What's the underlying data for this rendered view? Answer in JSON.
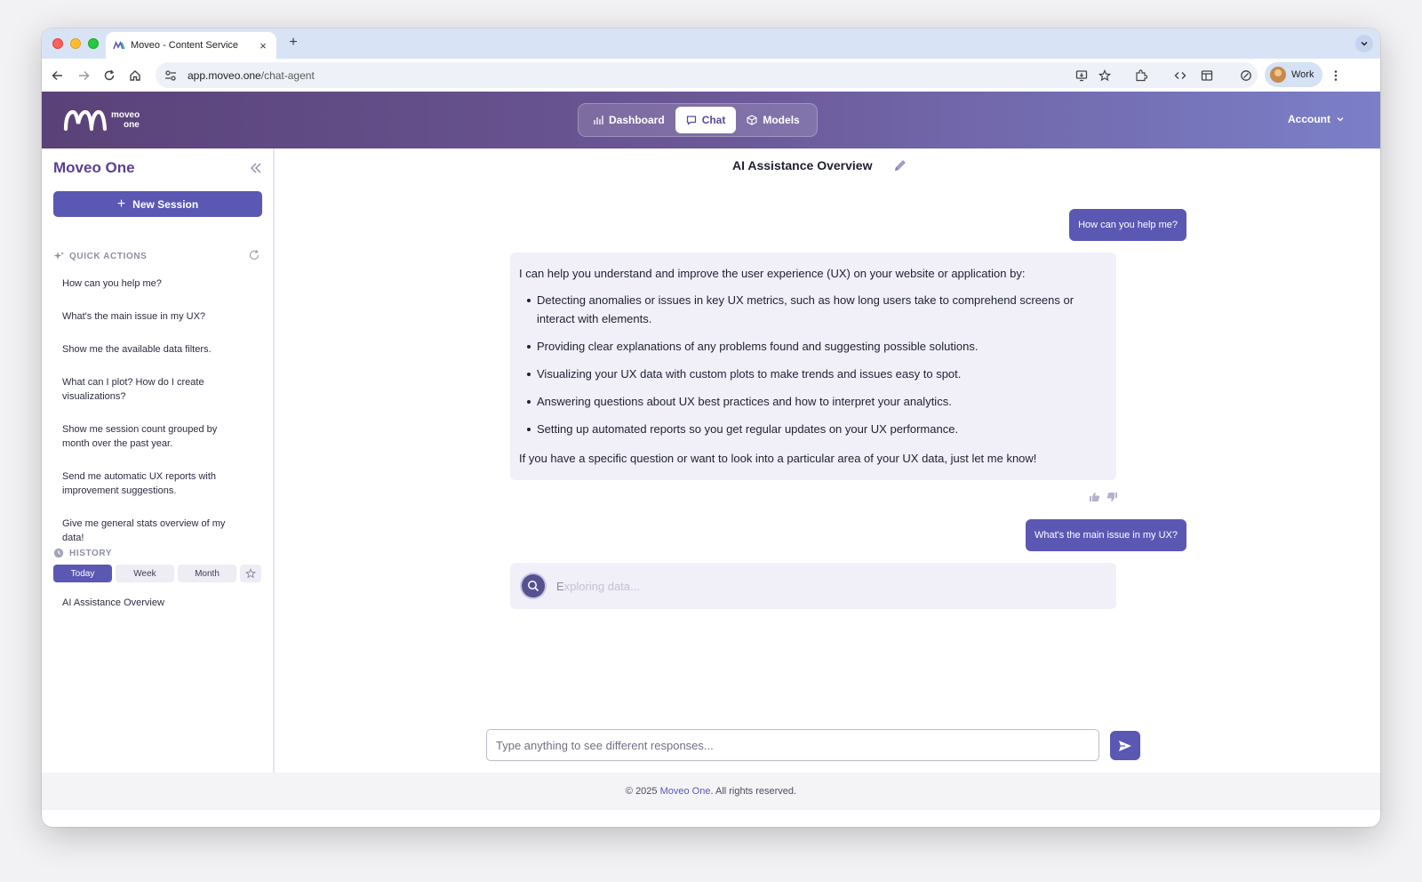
{
  "browser": {
    "tab_title": "Moveo - Content Service",
    "close_glyph": "×",
    "new_tab_glyph": "+",
    "url_host": "app.moveo.one",
    "url_path": "/chat-agent",
    "profile_label": "Work"
  },
  "header": {
    "logo_line1": "moveo",
    "logo_line2": "one",
    "nav": {
      "dashboard": "Dashboard",
      "chat": "Chat",
      "models": "Models"
    },
    "account": "Account"
  },
  "sidebar": {
    "title": "Moveo One",
    "new_session_plus": "+",
    "new_session": "New Session",
    "quick_actions_heading": "QUICK ACTIONS",
    "quick_actions": [
      "How can you help me?",
      "What's the main issue in my UX?",
      "Show me the available data filters.",
      "What can I plot? How do I create visualizations?",
      "Show me session count grouped by month over the past year.",
      "Send me automatic UX reports with improvement suggestions.",
      "Give me general stats overview of my data!"
    ],
    "history_heading": "HISTORY",
    "history_tabs": {
      "today": "Today",
      "week": "Week",
      "month": "Month"
    },
    "history_items": [
      "AI Assistance Overview"
    ]
  },
  "chat": {
    "title": "AI Assistance Overview",
    "messages": {
      "user1": "How can you help me?",
      "bot_intro": "I can help you understand and improve the user experience (UX) on your website or application by:",
      "bot_points": [
        "Detecting anomalies or issues in key UX metrics, such as how long users take to comprehend screens or interact with elements.",
        "Providing clear explanations of any problems found and suggesting possible solutions.",
        "Visualizing your UX data with custom plots to make trends and issues easy to spot.",
        "Answering questions about UX best practices and how to interpret your analytics.",
        "Setting up automated reports so you get regular updates on your UX performance."
      ],
      "bot_outro": "If you have a specific question or want to look into a particular area of your UX data, just let me know!",
      "user2": "What's the main issue in my UX?"
    },
    "loading_first": "E",
    "loading_rest": "xploring data...",
    "composer_placeholder": "Type anything to see different responses..."
  },
  "footer": {
    "prefix": "© 2025 ",
    "brand": "Moveo One",
    "suffix": ". All rights reserved."
  },
  "colors": {
    "accent": "#5b58b3",
    "sidebar_title": "#5b3f93",
    "header_gradient_start": "#5a4278",
    "header_gradient_end": "#7b7fc8"
  }
}
